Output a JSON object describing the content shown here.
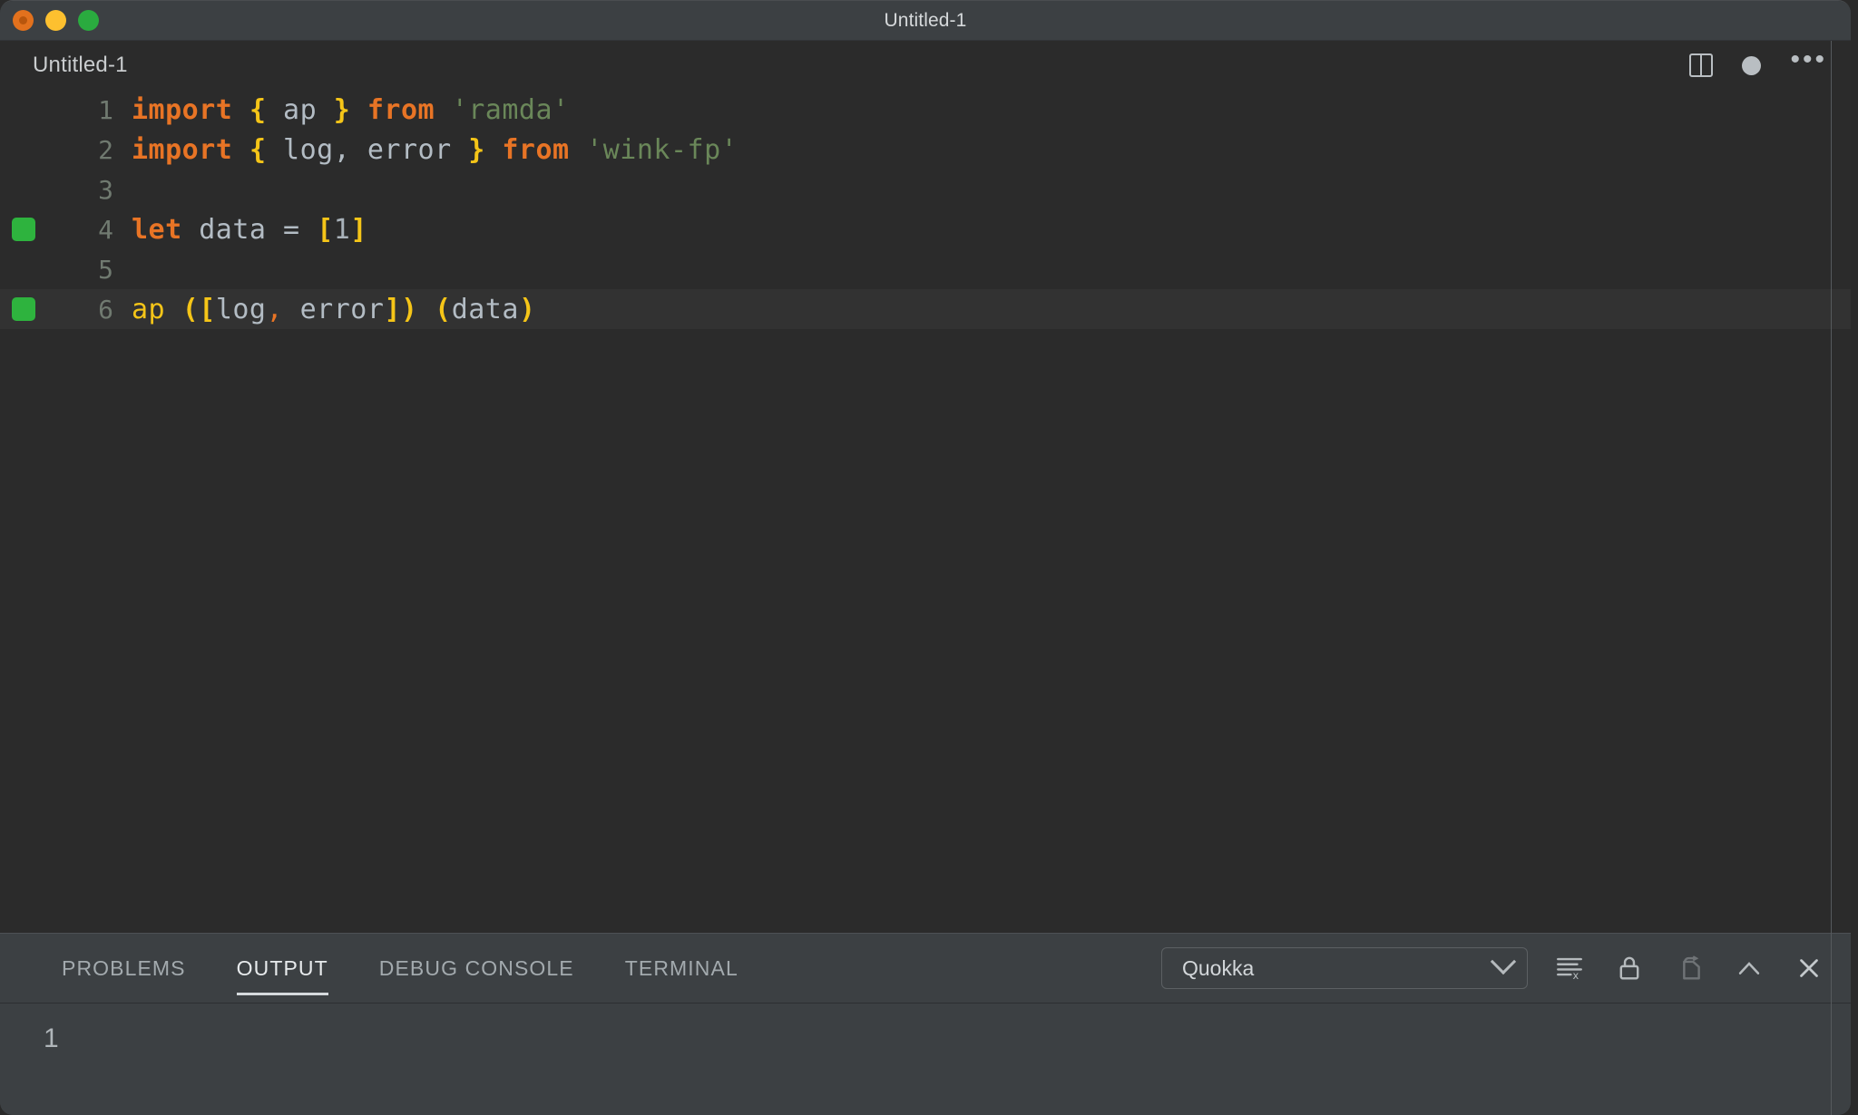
{
  "window": {
    "title": "Untitled-1",
    "traffic_lights": [
      {
        "name": "close",
        "color": "#e2711d"
      },
      {
        "name": "minimize",
        "color": "#fdc02f"
      },
      {
        "name": "maximize",
        "color": "#2aab3f"
      }
    ]
  },
  "editor_tab": {
    "label": "Untitled-1",
    "actions": [
      {
        "icon": "split-editor-icon"
      },
      {
        "icon": "unsaved-dot-icon"
      },
      {
        "icon": "more-actions-icon",
        "glyph": "•••"
      }
    ]
  },
  "editor": {
    "language": "javascript",
    "lines": [
      {
        "number": "1",
        "marker": false,
        "active": false,
        "text": "import { ap } from 'ramda'",
        "tokens": [
          {
            "t": "import",
            "c": "kw"
          },
          {
            "t": " ",
            "c": "punc"
          },
          {
            "t": "{",
            "c": "brace"
          },
          {
            "t": " ap ",
            "c": "ident"
          },
          {
            "t": "}",
            "c": "brace"
          },
          {
            "t": " ",
            "c": "punc"
          },
          {
            "t": "from",
            "c": "kw"
          },
          {
            "t": " ",
            "c": "punc"
          },
          {
            "t": "'ramda'",
            "c": "str"
          }
        ]
      },
      {
        "number": "2",
        "marker": false,
        "active": false,
        "text": "import { log, error } from 'wink-fp'",
        "tokens": [
          {
            "t": "import",
            "c": "kw"
          },
          {
            "t": " ",
            "c": "punc"
          },
          {
            "t": "{",
            "c": "brace"
          },
          {
            "t": " log, error ",
            "c": "ident"
          },
          {
            "t": "}",
            "c": "brace"
          },
          {
            "t": " ",
            "c": "punc"
          },
          {
            "t": "from",
            "c": "kw"
          },
          {
            "t": " ",
            "c": "punc"
          },
          {
            "t": "'wink-fp'",
            "c": "str"
          }
        ]
      },
      {
        "number": "3",
        "marker": false,
        "active": false,
        "text": "",
        "tokens": []
      },
      {
        "number": "4",
        "marker": true,
        "active": false,
        "text": "let data = [1]",
        "tokens": [
          {
            "t": "let",
            "c": "kw"
          },
          {
            "t": " data = ",
            "c": "ident"
          },
          {
            "t": "[",
            "c": "brace"
          },
          {
            "t": "1",
            "c": "num"
          },
          {
            "t": "]",
            "c": "brace"
          }
        ]
      },
      {
        "number": "5",
        "marker": false,
        "active": false,
        "text": "",
        "tokens": []
      },
      {
        "number": "6",
        "marker": true,
        "active": true,
        "text": "ap ([log, error]) (data)",
        "tokens": [
          {
            "t": "ap",
            "c": "fn"
          },
          {
            "t": " ",
            "c": "punc"
          },
          {
            "t": "([",
            "c": "brace"
          },
          {
            "t": "log",
            "c": "ident"
          },
          {
            "t": ",",
            "c": "comma-o"
          },
          {
            "t": " error",
            "c": "ident"
          },
          {
            "t": "])",
            "c": "brace"
          },
          {
            "t": " ",
            "c": "punc"
          },
          {
            "t": "(",
            "c": "brace"
          },
          {
            "t": "data",
            "c": "ident"
          },
          {
            "t": ")",
            "c": "brace"
          }
        ]
      }
    ],
    "marker_color": "#2eb33e"
  },
  "panel": {
    "tabs": [
      {
        "label": "PROBLEMS",
        "active": false
      },
      {
        "label": "OUTPUT",
        "active": true
      },
      {
        "label": "DEBUG CONSOLE",
        "active": false
      },
      {
        "label": "TERMINAL",
        "active": false
      }
    ],
    "source_select": {
      "value": "Quokka",
      "options": [
        "Quokka"
      ]
    },
    "controls": [
      {
        "name": "clear-output-button",
        "icon": "clear-output-icon",
        "disabled": false
      },
      {
        "name": "turn-auto-scrolling-off-button",
        "icon": "lock-icon",
        "disabled": false
      },
      {
        "name": "open-output-in-editor-button",
        "icon": "open-in-editor-icon",
        "disabled": true
      },
      {
        "name": "maximize-panel-button",
        "icon": "chevron-up-icon",
        "disabled": false
      },
      {
        "name": "close-panel-button",
        "icon": "close-icon",
        "disabled": false
      }
    ],
    "output_lines": [
      "1"
    ]
  }
}
